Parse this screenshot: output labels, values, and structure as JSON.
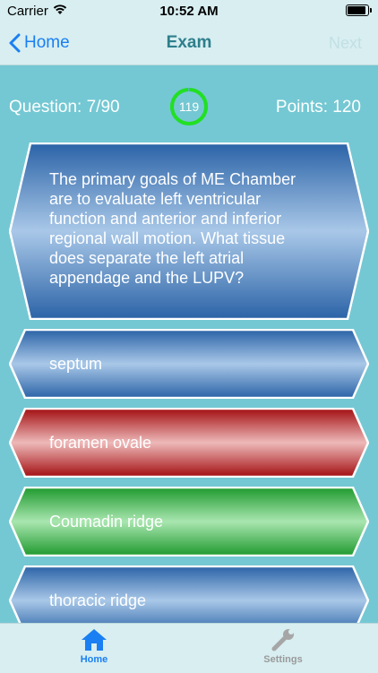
{
  "status_bar": {
    "carrier": "Carrier",
    "time": "10:52 AM"
  },
  "nav": {
    "back_label": "Home",
    "title": "Exam",
    "next_label": "Next"
  },
  "info": {
    "question_label": "Question: 7/90",
    "timer_value": "119",
    "timer_fraction": 0.99,
    "points_label": "Points: 120"
  },
  "question": {
    "lines": [
      "The primary goals of ME Chamber",
      "are to evaluate left ventricular",
      "function and anterior and inferior",
      "regional wall motion. What tissue",
      "does separate the left atrial",
      "appendage and the LUPV?"
    ]
  },
  "answers": [
    {
      "label": "septum",
      "state": "neutral"
    },
    {
      "label": "foramen ovale",
      "state": "wrong"
    },
    {
      "label": "Coumadin ridge",
      "state": "correct"
    },
    {
      "label": "thoracic ridge",
      "state": "neutral"
    }
  ],
  "tabs": {
    "home_label": "Home",
    "settings_label": "Settings"
  },
  "colors": {
    "accent": "#1a7ff2",
    "timer_ring": "#22e022",
    "neutral": "#3c7ec0",
    "wrong": "#b01818",
    "correct": "#2fa83f"
  }
}
